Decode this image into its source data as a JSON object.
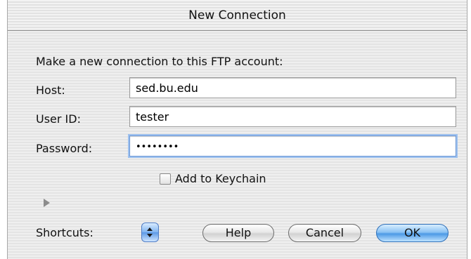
{
  "window": {
    "title": "New Connection"
  },
  "form": {
    "prompt": "Make a new connection to this FTP account:",
    "host_label": "Host:",
    "host_value": "sed.bu.edu",
    "user_label": "User ID:",
    "user_value": "tester",
    "password_label": "Password:",
    "password_value": "••••••••",
    "keychain_label": "Add to Keychain",
    "keychain_checked": false
  },
  "footer": {
    "shortcuts_label": "Shortcuts:",
    "help_label": "Help",
    "cancel_label": "Cancel",
    "ok_label": "OK"
  },
  "icons": {
    "disclosure": "disclosure-triangle-icon",
    "shortcuts_stepper": "up-down-stepper-icon"
  },
  "colors": {
    "focus_ring": "#9ec1ee",
    "default_button": "#4d9ae6"
  }
}
